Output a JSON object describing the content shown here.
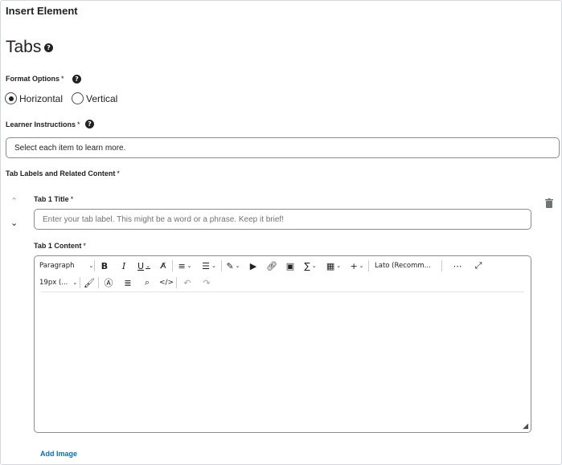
{
  "dialog_title": "Insert Element",
  "page_title": "Tabs",
  "format_options": {
    "label": "Format Options",
    "required_marker": "*",
    "options": [
      "Horizontal",
      "Vertical"
    ],
    "selected": "Horizontal"
  },
  "learner_instructions": {
    "label": "Learner Instructions",
    "required_marker": "*",
    "value": "Select each item to learn more."
  },
  "tab_section": {
    "label": "Tab Labels and Related Content",
    "required_marker": "*"
  },
  "tab1": {
    "title_label": "Tab 1 Title",
    "title_placeholder": "Enter your tab label. This might be a word or a phrase. Keep it brief!",
    "content_label": "Tab 1 Content",
    "required_marker": "*"
  },
  "editor": {
    "paragraph_format": "Paragraph",
    "font_family": "Lato (Recomm...",
    "font_size": "19px (...",
    "content": ""
  },
  "add_image_label": "Add Image",
  "icons": {
    "help": "help-icon",
    "move_up": "chevron-up-icon",
    "move_down": "chevron-down-icon",
    "delete": "trash-icon"
  },
  "colors": {
    "link": "#006fbf",
    "border": "#868c8f",
    "text": "#202122"
  }
}
